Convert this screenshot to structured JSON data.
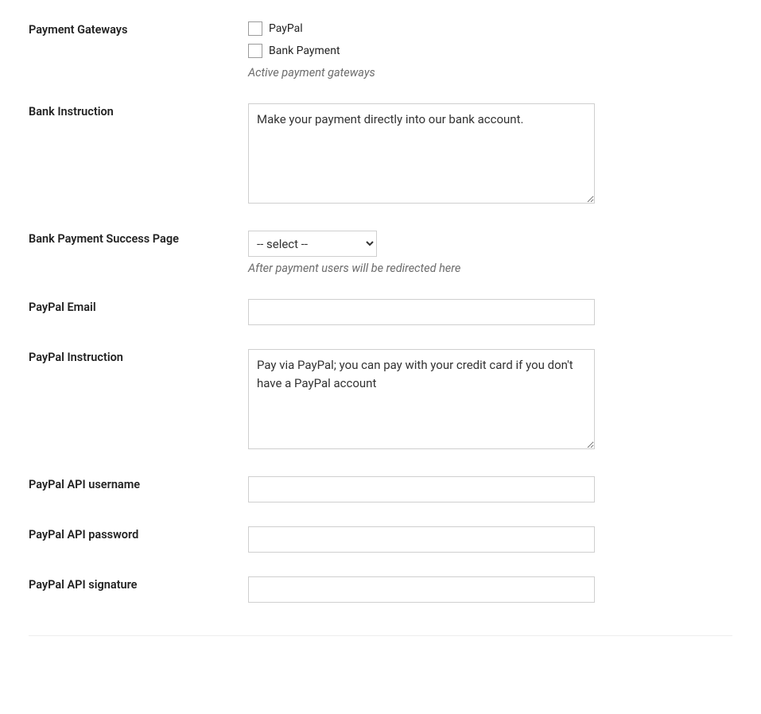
{
  "fields": {
    "payment_gateways": {
      "label": "Payment Gateways",
      "options": {
        "paypal": "PayPal",
        "bank": "Bank Payment"
      },
      "hint": "Active payment gateways"
    },
    "bank_instruction": {
      "label": "Bank Instruction",
      "value": "Make your payment directly into our bank account."
    },
    "bank_success_page": {
      "label": "Bank Payment Success Page",
      "placeholder_option": "-- select --",
      "hint": "After payment users will be redirected here"
    },
    "paypal_email": {
      "label": "PayPal Email",
      "value": ""
    },
    "paypal_instruction": {
      "label": "PayPal Instruction",
      "value": "Pay via PayPal; you can pay with your credit card if you don't have a PayPal account"
    },
    "paypal_api_username": {
      "label": "PayPal API username",
      "value": ""
    },
    "paypal_api_password": {
      "label": "PayPal API password",
      "value": ""
    },
    "paypal_api_signature": {
      "label": "PayPal API signature",
      "value": ""
    }
  }
}
